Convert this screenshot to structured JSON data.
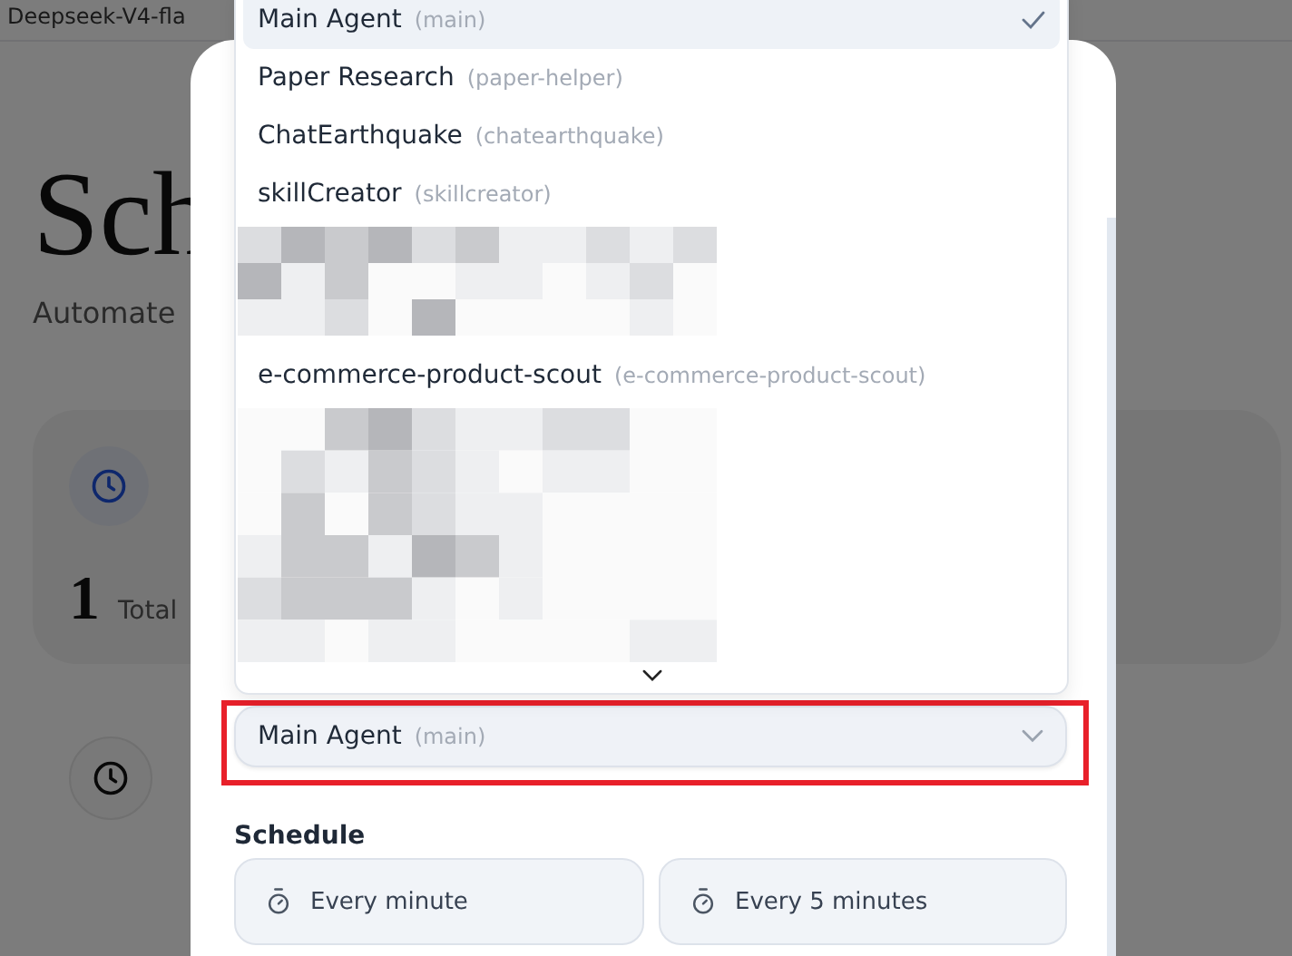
{
  "browser_tab": {
    "title": "Deepseek-V4-fla"
  },
  "page": {
    "title": "Sch",
    "subtitle": "Automate"
  },
  "stats": {
    "value": "1",
    "label": "Total"
  },
  "agent_dropdown": {
    "items": [
      {
        "kind": "agent",
        "name": "Main Agent",
        "id": "(main)",
        "selected": true
      },
      {
        "kind": "agent",
        "name": "Paper Research",
        "id": "(paper-helper)",
        "selected": false
      },
      {
        "kind": "agent",
        "name": "ChatEarthquake",
        "id": "(chatearthquake)",
        "selected": false
      },
      {
        "kind": "agent",
        "name": "skillCreator",
        "id": "(skillcreator)",
        "selected": false
      },
      {
        "kind": "redacted"
      },
      {
        "kind": "agent",
        "name": "e-commerce-product-scout",
        "id": "(e-commerce-product-scout)",
        "selected": false
      },
      {
        "kind": "redacted"
      }
    ]
  },
  "agent_select": {
    "name": "Main Agent",
    "id": "(main)",
    "highlighted": true
  },
  "schedule": {
    "label": "Schedule",
    "options": [
      {
        "label": "Every minute",
        "selected": false
      },
      {
        "label": "Every 5 minutes",
        "selected": false
      }
    ]
  }
}
